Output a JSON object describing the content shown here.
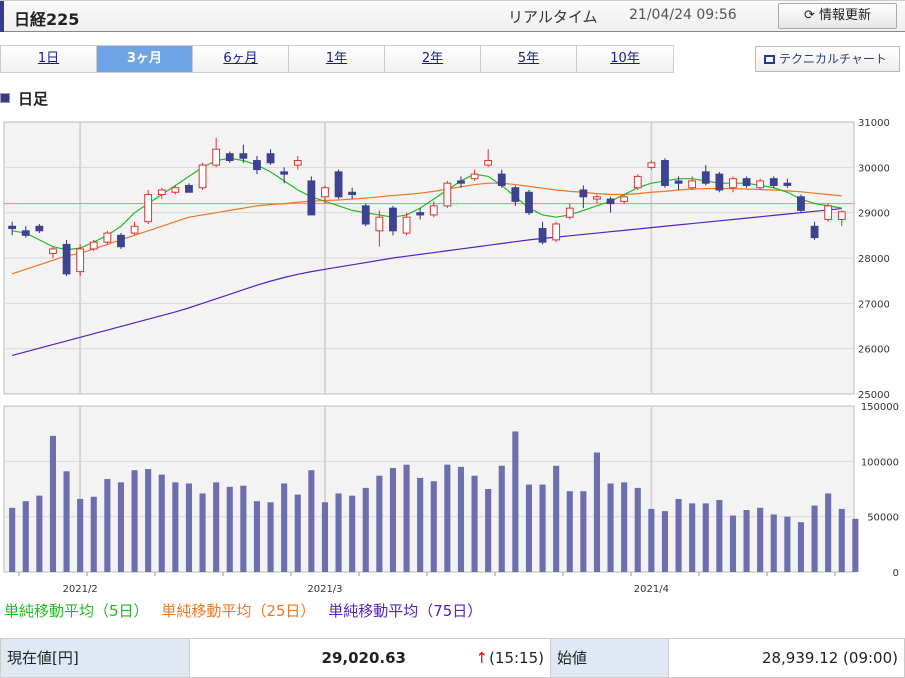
{
  "header": {
    "title": "日経225",
    "realtime_label": "リアルタイム",
    "timestamp": "21/04/24 09:56",
    "refresh_label": "情報更新",
    "refresh_icon": "refresh-icon"
  },
  "tabs": [
    {
      "label": "1日",
      "active": false
    },
    {
      "label": "3ヶ月",
      "active": true
    },
    {
      "label": "6ヶ月",
      "active": false
    },
    {
      "label": "1年",
      "active": false
    },
    {
      "label": "2年",
      "active": false
    },
    {
      "label": "5年",
      "active": false
    },
    {
      "label": "10年",
      "active": false
    }
  ],
  "technical_chart_label": "テクニカルチャート",
  "section_title": "日足",
  "legend": [
    {
      "label": "単純移動平均（5日）",
      "color": "#22bb22"
    },
    {
      "label": "単純移動平均（25日）",
      "color": "#ee7722"
    },
    {
      "label": "単純移動平均（75日）",
      "color": "#5522bb"
    }
  ],
  "chart_data": {
    "type": "candlestick",
    "price_axis": {
      "min": 25000,
      "max": 31000,
      "ticks": [
        25000,
        26000,
        27000,
        28000,
        29000,
        30000,
        31000
      ]
    },
    "volume_axis": {
      "min": 0,
      "max": 150000,
      "ticks": [
        0,
        50000,
        100000,
        150000
      ]
    },
    "reference_line": 29200,
    "x_labels": [
      {
        "index": 5,
        "label": "2021/2"
      },
      {
        "index": 23,
        "label": "2021/3"
      },
      {
        "index": 47,
        "label": "2021/4"
      }
    ],
    "candles": [
      [
        28700,
        28800,
        28500,
        28650
      ],
      [
        28600,
        28700,
        28450,
        28500
      ],
      [
        28700,
        28750,
        28550,
        28600
      ],
      [
        28100,
        28250,
        28000,
        28200
      ],
      [
        28300,
        28400,
        27600,
        27650
      ],
      [
        27700,
        28300,
        27600,
        28200
      ],
      [
        28200,
        28400,
        28150,
        28350
      ],
      [
        28350,
        28600,
        28300,
        28550
      ],
      [
        28500,
        28550,
        28200,
        28250
      ],
      [
        28550,
        28800,
        28500,
        28700
      ],
      [
        28800,
        29500,
        28750,
        29400
      ],
      [
        29400,
        29550,
        29300,
        29500
      ],
      [
        29450,
        29600,
        29400,
        29550
      ],
      [
        29600,
        29650,
        29450,
        29450
      ],
      [
        29550,
        30100,
        29500,
        30050
      ],
      [
        30050,
        30650,
        30000,
        30400
      ],
      [
        30300,
        30350,
        30100,
        30150
      ],
      [
        30300,
        30500,
        30100,
        30200
      ],
      [
        30150,
        30250,
        29850,
        29950
      ],
      [
        30300,
        30400,
        30050,
        30100
      ],
      [
        29900,
        30000,
        29650,
        29850
      ],
      [
        30050,
        30250,
        29950,
        30150
      ],
      [
        29700,
        29800,
        28950,
        28950
      ],
      [
        29350,
        29600,
        29200,
        29550
      ],
      [
        29900,
        29950,
        29300,
        29350
      ],
      [
        29450,
        29550,
        29300,
        29400
      ],
      [
        29150,
        29200,
        28700,
        28750
      ],
      [
        28600,
        29050,
        28250,
        28900
      ],
      [
        29100,
        29150,
        28500,
        28600
      ],
      [
        28550,
        29000,
        28500,
        28900
      ],
      [
        29000,
        29100,
        28850,
        28950
      ],
      [
        28950,
        29250,
        28900,
        29150
      ],
      [
        29150,
        29700,
        29100,
        29650
      ],
      [
        29700,
        29800,
        29550,
        29650
      ],
      [
        29750,
        29950,
        29700,
        29850
      ],
      [
        30050,
        30400,
        30000,
        30150
      ],
      [
        29850,
        29950,
        29550,
        29600
      ],
      [
        29550,
        29600,
        29150,
        29250
      ],
      [
        29450,
        29500,
        28950,
        29000
      ],
      [
        28650,
        28800,
        28300,
        28350
      ],
      [
        28400,
        28800,
        28350,
        28750
      ],
      [
        28900,
        29200,
        28850,
        29100
      ],
      [
        29500,
        29600,
        29100,
        29350
      ],
      [
        29300,
        29400,
        29200,
        29350
      ],
      [
        29300,
        29350,
        29000,
        29200
      ],
      [
        29250,
        29400,
        29200,
        29350
      ],
      [
        29550,
        29850,
        29500,
        29800
      ],
      [
        30000,
        30150,
        29950,
        30100
      ],
      [
        30150,
        30200,
        29550,
        29600
      ],
      [
        29700,
        29800,
        29500,
        29650
      ],
      [
        29550,
        29800,
        29500,
        29700
      ],
      [
        29900,
        30050,
        29600,
        29650
      ],
      [
        29850,
        29900,
        29450,
        29500
      ],
      [
        29550,
        29800,
        29450,
        29750
      ],
      [
        29750,
        29800,
        29550,
        29600
      ],
      [
        29550,
        29750,
        29500,
        29700
      ],
      [
        29750,
        29800,
        29550,
        29600
      ],
      [
        29650,
        29750,
        29550,
        29600
      ],
      [
        29350,
        29400,
        29000,
        29050
      ],
      [
        28700,
        28800,
        28400,
        28450
      ],
      [
        28850,
        29200,
        28800,
        29150
      ],
      [
        28850,
        29050,
        28700,
        29020
      ]
    ],
    "volume": [
      58000,
      64000,
      69000,
      123000,
      91000,
      66000,
      68000,
      84000,
      81000,
      92000,
      93000,
      88000,
      81000,
      80000,
      71000,
      81000,
      77000,
      78000,
      64000,
      63000,
      80000,
      70000,
      92000,
      63000,
      71000,
      69000,
      76000,
      87000,
      94000,
      97000,
      85000,
      82000,
      97000,
      95000,
      87000,
      75000,
      96000,
      127000,
      79000,
      79000,
      96000,
      73000,
      73000,
      108000,
      80000,
      81000,
      76000,
      57000,
      55000,
      66000,
      62000,
      62000,
      65000,
      51000,
      56000,
      58000,
      52000,
      50000,
      45000,
      60000,
      71000,
      57000,
      48000
    ],
    "ma5": [
      28600,
      28550,
      28400,
      28250,
      28180,
      28220,
      28350,
      28500,
      28700,
      29000,
      29200,
      29400,
      29600,
      29800,
      30000,
      30150,
      30200,
      30150,
      30050,
      29900,
      29700,
      29500,
      29350,
      29250,
      29150,
      29050,
      29000,
      28950,
      28900,
      28950,
      29100,
      29300,
      29500,
      29700,
      29850,
      29800,
      29600,
      29350,
      29100,
      28950,
      28900,
      28950,
      29050,
      29150,
      29250,
      29400,
      29550,
      29650,
      29700,
      29750,
      29750,
      29700,
      29650,
      29650,
      29650,
      29600,
      29550,
      29450,
      29300,
      29200,
      29150,
      29100
    ],
    "ma25": [
      27650,
      27750,
      27850,
      27950,
      28050,
      28100,
      28200,
      28300,
      28400,
      28500,
      28600,
      28700,
      28800,
      28900,
      28950,
      29000,
      29050,
      29100,
      29150,
      29180,
      29200,
      29230,
      29250,
      29270,
      29280,
      29300,
      29320,
      29350,
      29380,
      29400,
      29430,
      29470,
      29520,
      29570,
      29620,
      29650,
      29650,
      29620,
      29580,
      29540,
      29500,
      29470,
      29450,
      29420,
      29400,
      29400,
      29420,
      29450,
      29470,
      29500,
      29520,
      29530,
      29530,
      29530,
      29520,
      29510,
      29500,
      29480,
      29460,
      29430,
      29400,
      29370
    ],
    "ma75": [
      25850,
      25930,
      26010,
      26090,
      26170,
      26250,
      26330,
      26410,
      26490,
      26570,
      26650,
      26730,
      26810,
      26900,
      27000,
      27100,
      27200,
      27300,
      27400,
      27490,
      27570,
      27640,
      27700,
      27750,
      27800,
      27850,
      27900,
      27950,
      28000,
      28040,
      28080,
      28120,
      28160,
      28200,
      28240,
      28280,
      28320,
      28360,
      28400,
      28430,
      28460,
      28490,
      28520,
      28550,
      28580,
      28610,
      28640,
      28670,
      28700,
      28730,
      28760,
      28790,
      28820,
      28850,
      28880,
      28910,
      28940,
      28970,
      29000,
      29030,
      29060,
      29090
    ]
  },
  "quote": {
    "current_label": "現在値[円]",
    "current_value": "29,020.63",
    "arrow": "↑",
    "current_time": "(15:15)",
    "open_label": "始値",
    "open_value": "28,939.12 (09:00)"
  }
}
